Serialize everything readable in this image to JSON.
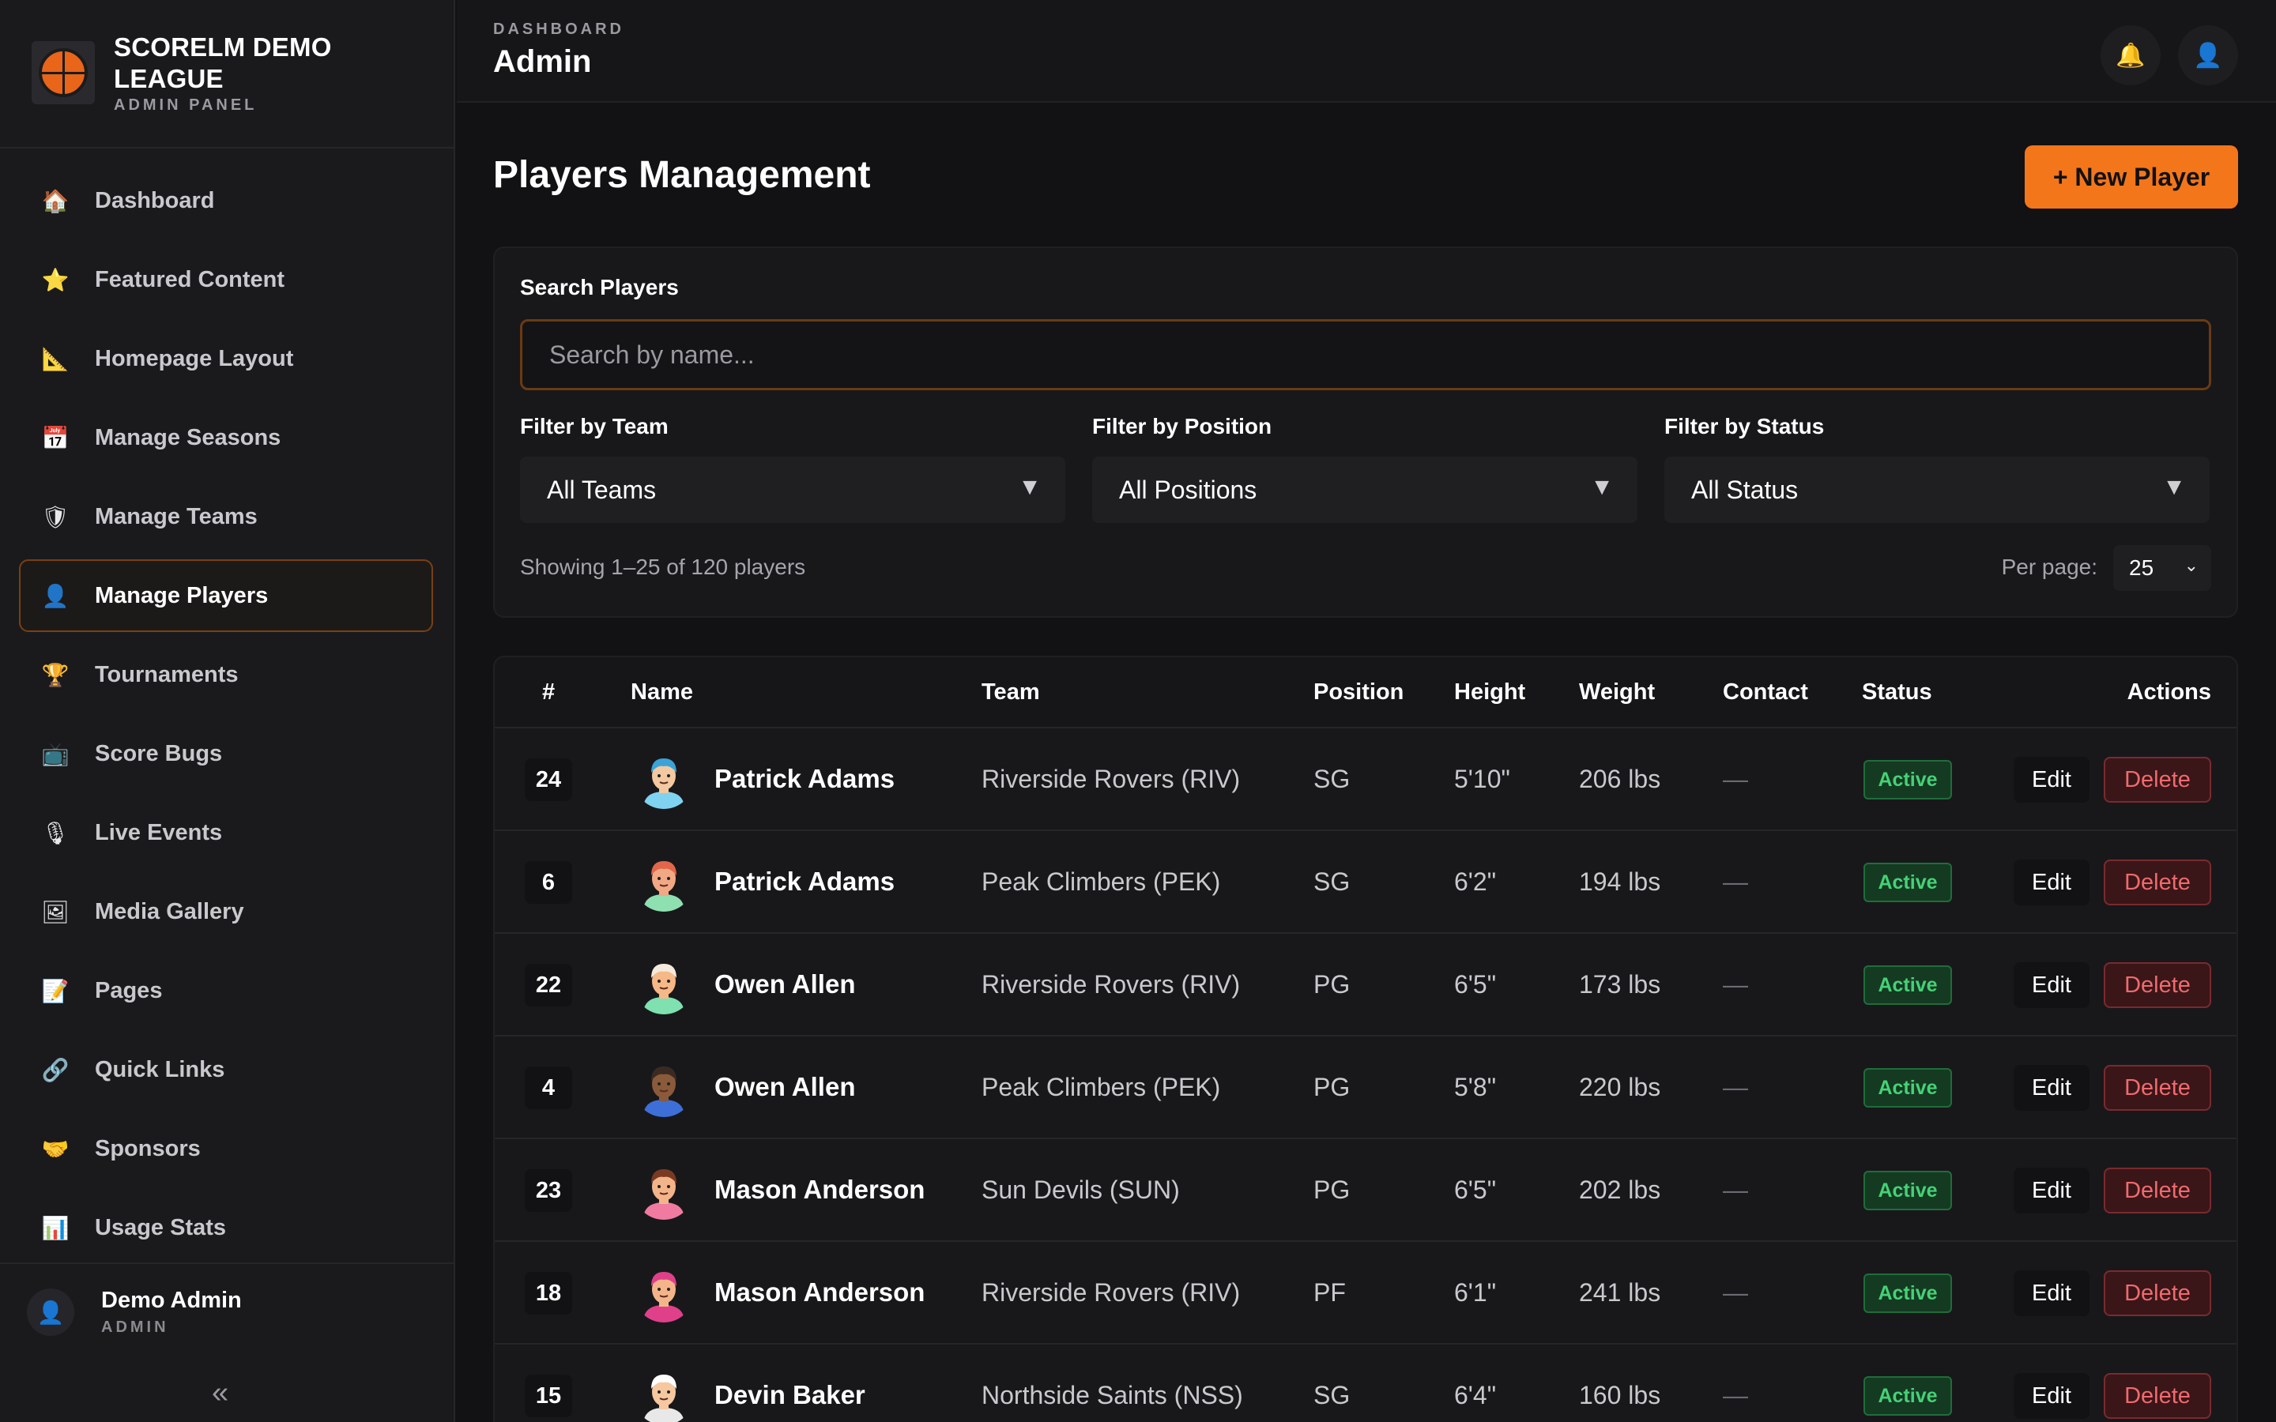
{
  "brand": {
    "title": "SCORELM DEMO LEAGUE",
    "subtitle": "ADMIN PANEL",
    "logo_icon": "basketball-logo-icon"
  },
  "sidebar": {
    "items": [
      {
        "label": "Dashboard",
        "icon": "🏠",
        "icon_name": "home-icon"
      },
      {
        "label": "Featured Content",
        "icon": "⭐",
        "icon_name": "star-icon"
      },
      {
        "label": "Homepage Layout",
        "icon": "📐",
        "icon_name": "ruler-icon"
      },
      {
        "label": "Manage Seasons",
        "icon": "📅",
        "icon_name": "calendar-icon"
      },
      {
        "label": "Manage Teams",
        "icon": "🛡",
        "icon_name": "shield-icon"
      },
      {
        "label": "Manage Players",
        "icon": "👤",
        "icon_name": "user-icon",
        "active": true
      },
      {
        "label": "Tournaments",
        "icon": "🏆",
        "icon_name": "trophy-icon"
      },
      {
        "label": "Score Bugs",
        "icon": "📺",
        "icon_name": "tv-icon"
      },
      {
        "label": "Live Events",
        "icon": "🎙",
        "icon_name": "microphone-icon"
      },
      {
        "label": "Media Gallery",
        "icon": "🖼",
        "icon_name": "image-icon"
      },
      {
        "label": "Pages",
        "icon": "📝",
        "icon_name": "memo-icon"
      },
      {
        "label": "Quick Links",
        "icon": "🔗",
        "icon_name": "link-icon"
      },
      {
        "label": "Sponsors",
        "icon": "🤝",
        "icon_name": "handshake-icon"
      },
      {
        "label": "Usage Stats",
        "icon": "📊",
        "icon_name": "bar-chart-icon"
      }
    ]
  },
  "user": {
    "name": "Demo Admin",
    "role": "ADMIN",
    "avatar_icon": "👤",
    "collapse_icon": "«"
  },
  "topbar": {
    "breadcrumb": "DASHBOARD",
    "title": "Admin",
    "bell_icon": "🔔",
    "profile_icon": "👤"
  },
  "main": {
    "title": "Players Management",
    "new_button": "+ New Player",
    "search_label": "Search Players",
    "search_placeholder": "Search by name...",
    "search_value": "",
    "filters": [
      {
        "label": "Filter by Team",
        "value": "All Teams"
      },
      {
        "label": "Filter by Position",
        "value": "All Positions"
      },
      {
        "label": "Filter by Status",
        "value": "All Status"
      }
    ],
    "caret": "▼",
    "showing": "Showing 1–25 of 120 players",
    "per_page_label": "Per page:",
    "per_page_value": "25",
    "per_page_chevron": "⌄"
  },
  "table": {
    "columns": [
      "#",
      "Name",
      "Team",
      "Position",
      "Height",
      "Weight",
      "Contact",
      "Status",
      "Actions"
    ],
    "edit_label": "Edit",
    "delete_label": "Delete",
    "rows": [
      {
        "number": "24",
        "name": "Patrick Adams",
        "team": "Riverside Rovers (RIV)",
        "position": "SG",
        "height": "5'10\"",
        "weight": "206 lbs",
        "contact": "—",
        "status": "Active",
        "skin": "#f2c9a0",
        "hair": "#3ba3d8",
        "shirt": "#7fd3f0"
      },
      {
        "number": "6",
        "name": "Patrick Adams",
        "team": "Peak Climbers (PEK)",
        "position": "SG",
        "height": "6'2\"",
        "weight": "194 lbs",
        "contact": "—",
        "status": "Active",
        "skin": "#f1a884",
        "hair": "#e2674a",
        "shirt": "#8fe0b0"
      },
      {
        "number": "22",
        "name": "Owen Allen",
        "team": "Riverside Rovers (RIV)",
        "position": "PG",
        "height": "6'5\"",
        "weight": "173 lbs",
        "contact": "—",
        "status": "Active",
        "skin": "#f6b886",
        "hair": "#f3e9dc",
        "shirt": "#7fe0b0"
      },
      {
        "number": "4",
        "name": "Owen Allen",
        "team": "Peak Climbers (PEK)",
        "position": "PG",
        "height": "5'8\"",
        "weight": "220 lbs",
        "contact": "—",
        "status": "Active",
        "skin": "#8a5a3a",
        "hair": "#3a2a22",
        "shirt": "#3e6fd8"
      },
      {
        "number": "23",
        "name": "Mason Anderson",
        "team": "Sun Devils (SUN)",
        "position": "PG",
        "height": "6'5\"",
        "weight": "202 lbs",
        "contact": "—",
        "status": "Active",
        "skin": "#f4b48a",
        "hair": "#7a3a22",
        "shirt": "#f07aa0"
      },
      {
        "number": "18",
        "name": "Mason Anderson",
        "team": "Riverside Rovers (RIV)",
        "position": "PF",
        "height": "6'1\"",
        "weight": "241 lbs",
        "contact": "—",
        "status": "Active",
        "skin": "#f4b48a",
        "hair": "#e0408a",
        "shirt": "#e0408a"
      },
      {
        "number": "15",
        "name": "Devin Baker",
        "team": "Northside Saints (NSS)",
        "position": "SG",
        "height": "6'4\"",
        "weight": "160 lbs",
        "contact": "—",
        "status": "Active",
        "skin": "#f6c8a0",
        "hair": "#ffffff",
        "shirt": "#e8e8e8"
      }
    ]
  }
}
